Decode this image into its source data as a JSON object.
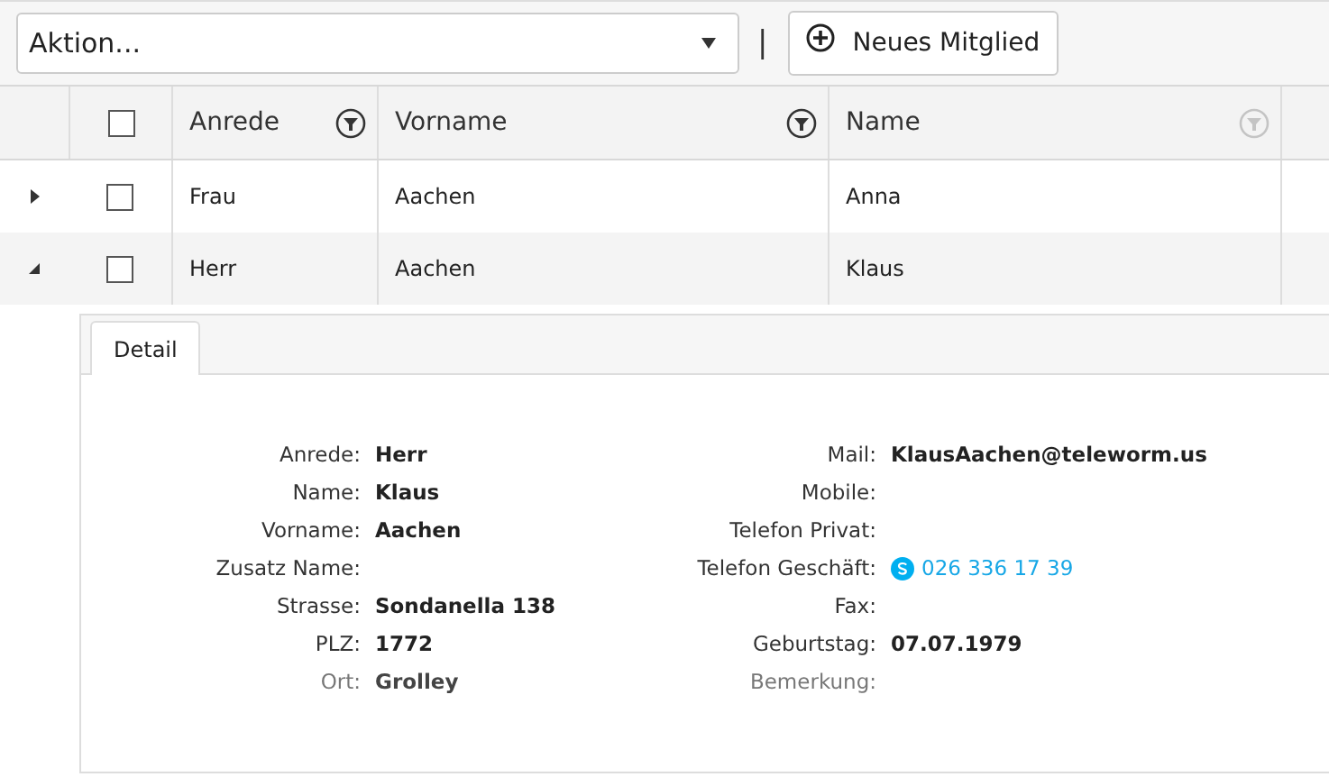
{
  "toolbar": {
    "action_select": {
      "value": "Aktion..."
    },
    "separator": "|",
    "new_button": {
      "label": "Neues Mitglied"
    }
  },
  "table": {
    "columns": [
      {
        "label": "Anrede",
        "filter_active": true
      },
      {
        "label": "Vorname",
        "filter_active": true
      },
      {
        "label": "Name",
        "filter_active": false
      }
    ],
    "select_all_checked": false,
    "rows": [
      {
        "expanded": false,
        "checked": false,
        "cells": [
          "Frau",
          "Aachen",
          "Anna"
        ]
      },
      {
        "expanded": true,
        "checked": false,
        "cells": [
          "Herr",
          "Aachen",
          "Klaus"
        ]
      }
    ]
  },
  "detail": {
    "tabs": [
      {
        "label": "Detail",
        "selected": true
      }
    ],
    "left_fields": [
      {
        "label": "Anrede:",
        "value": "Herr"
      },
      {
        "label": "Name:",
        "value": "Klaus"
      },
      {
        "label": "Vorname:",
        "value": "Aachen"
      },
      {
        "label": "Zusatz Name:"
      },
      {
        "label": "Strasse:",
        "value": "Sondanella 138"
      },
      {
        "label": "PLZ:",
        "value": "1772"
      },
      {
        "label": "Ort:",
        "value": "Grolley"
      }
    ],
    "right_fields": [
      {
        "label": "Mail:",
        "value": "KlausAachen@teleworm.us"
      },
      {
        "label": "Mobile:"
      },
      {
        "label": "Telefon Privat:"
      },
      {
        "label": "Telefon Geschäft:",
        "value": "026 336 17 39",
        "kind": "phone"
      },
      {
        "label": "Fax:"
      },
      {
        "label": "Geburtstag:",
        "value": "07.07.1979"
      },
      {
        "label": "Bemerkung:"
      }
    ]
  }
}
